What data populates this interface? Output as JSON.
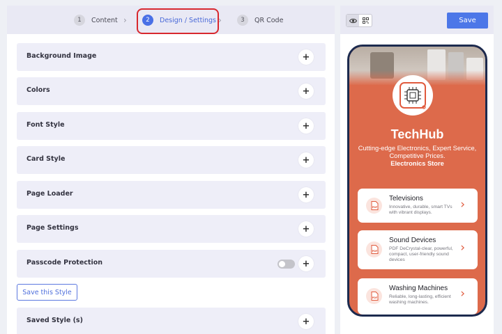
{
  "stepper": {
    "steps": [
      {
        "num": "1",
        "label": "Content"
      },
      {
        "num": "2",
        "label": "Design / Settings"
      },
      {
        "num": "3",
        "label": "QR Code"
      }
    ],
    "active_step": "2"
  },
  "sections": [
    {
      "label": "Background Image"
    },
    {
      "label": "Colors"
    },
    {
      "label": "Font Style"
    },
    {
      "label": "Card Style"
    },
    {
      "label": "Page Loader"
    },
    {
      "label": "Page Settings"
    },
    {
      "label": "Passcode Protection",
      "toggle": "off"
    }
  ],
  "save_style_label": "Save this Style",
  "saved_styles_label": "Saved Style (s)",
  "toolbar": {
    "save_label": "Save",
    "view_modes": [
      "eye-icon",
      "qr-icon"
    ],
    "active_view": "eye-icon"
  },
  "preview": {
    "brand_name": "TechHub",
    "tagline": "Cutting-edge Electronics, Expert Service, Competitive Prices.",
    "category": "Electronics Store",
    "colors": {
      "background": "#dd6a4b",
      "frame": "#1c2a4e",
      "accent": "#e05a3d"
    },
    "cards": [
      {
        "title": "Televisions",
        "description": "Innovative, durable, smart TVs with vibrant displays.",
        "icon": "pdf-icon"
      },
      {
        "title": "Sound Devices",
        "description": "PDF DeCrystal-clear, powerful, compact, user-friendly sound devices",
        "icon": "pdf-icon"
      },
      {
        "title": "Washing Machines",
        "description": "Reliable, long-lasting, efficient washing machines.",
        "icon": "pdf-icon"
      }
    ]
  }
}
